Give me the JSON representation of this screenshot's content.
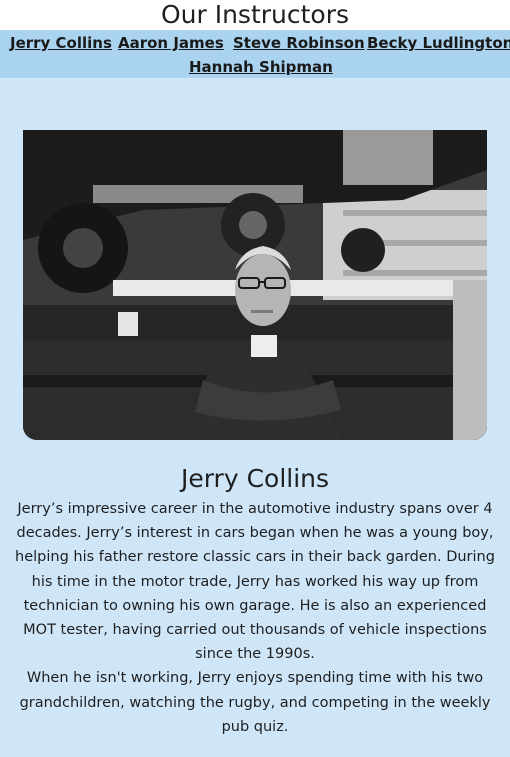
{
  "header": {
    "title": "Our Instructors"
  },
  "nav": {
    "links": [
      {
        "label": "Jerry Collins"
      },
      {
        "label": "Aaron James"
      },
      {
        "label": "Steve Robinson"
      },
      {
        "label": "Becky Ludlington"
      },
      {
        "label": "Hannah Shipman"
      }
    ]
  },
  "profile": {
    "name": "Jerry Collins",
    "bio_paragraph_1": "Jerry’s impressive career in the automotive industry spans over 4 decades. Jerry’s interest in cars began when he was a young boy, helping his father restore classic cars in their back garden. During his time in the motor trade, Jerry has worked his way up from technician to owning his own garage. He is also an experienced MOT tester, having carried out thousands of vehicle inspections since the 1990s.",
    "bio_paragraph_2": "When he isn't working, Jerry enjoys spending time with his two grandchildren, watching the rugby, and competing in the weekly pub quiz."
  },
  "colors": {
    "nav_background": "#a9d3ef",
    "page_background": "#cfe6f8",
    "text": "#1f1f1f"
  }
}
